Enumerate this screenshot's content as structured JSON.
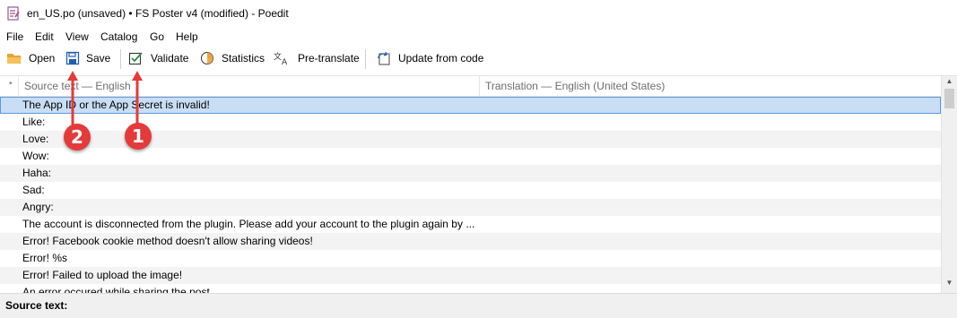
{
  "window": {
    "title": "en_US.po (unsaved) • FS Poster v4 (modified) - Poedit"
  },
  "menu": [
    "File",
    "Edit",
    "View",
    "Catalog",
    "Go",
    "Help"
  ],
  "toolbar": {
    "open": "Open",
    "save": "Save",
    "validate": "Validate",
    "statistics": "Statistics",
    "pretranslate": "Pre-translate",
    "update": "Update from code"
  },
  "list": {
    "columns": [
      "Source text — English",
      "Translation — English (United States)"
    ],
    "rows": [
      "The App ID or the App Secret is invalid!",
      "Like:",
      "Love:",
      "Wow:",
      "Haha:",
      "Sad:",
      "Angry:",
      "The account is disconnected from the plugin. Please add your account to the plugin again by ...",
      "Error! Facebook cookie method doesn't allow sharing videos!",
      "Error! %s",
      "Error! Failed to upload the image!",
      "An error occured while sharing the post."
    ]
  },
  "status": {
    "label": "Source text:"
  },
  "annotations": {
    "badge1": "1",
    "badge2": "2"
  },
  "colors": {
    "selected_row": "#c9def5",
    "badge": "#e53a3a",
    "icon_blue": "#1f5fb0",
    "icon_orange": "#e8a23a"
  }
}
